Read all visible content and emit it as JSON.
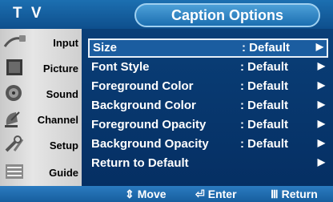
{
  "header": {
    "app_title": "T V",
    "menu_title": "Caption Options"
  },
  "sidebar": {
    "items": [
      {
        "label": "Input"
      },
      {
        "label": "Picture"
      },
      {
        "label": "Sound"
      },
      {
        "label": "Channel"
      },
      {
        "label": "Setup"
      },
      {
        "label": "Guide"
      }
    ]
  },
  "menu": {
    "rows": [
      {
        "name": "Size",
        "value": ": Default",
        "selected": true
      },
      {
        "name": "Font Style",
        "value": ": Default"
      },
      {
        "name": "Foreground Color",
        "value": ": Default"
      },
      {
        "name": "Background Color",
        "value": ": Default"
      },
      {
        "name": "Foreground Opacity",
        "value": ": Default"
      },
      {
        "name": "Background Opacity",
        "value": ": Default"
      },
      {
        "name": "Return to Default",
        "value": ""
      }
    ],
    "arrow_glyph": "▶"
  },
  "footer": {
    "move_icon": "⇕",
    "move_label": "Move",
    "enter_icon": "⏎",
    "enter_label": "Enter",
    "return_icon": "Ⅲ",
    "return_label": "Return"
  },
  "colors": {
    "background": "#05356b",
    "accent": "#1c6fb1",
    "sidebar": "#d8d8d8"
  }
}
